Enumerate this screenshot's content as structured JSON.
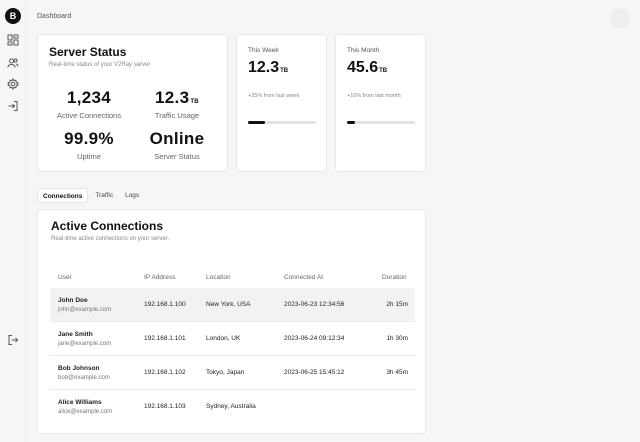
{
  "sidebar": {
    "logo": "B",
    "items": [
      {
        "icon": "dashboard-icon"
      },
      {
        "icon": "users-icon"
      },
      {
        "icon": "settings-icon"
      },
      {
        "icon": "login-icon"
      }
    ],
    "footer_icon": "logout-icon"
  },
  "header": {
    "breadcrumb": "Dashboard"
  },
  "server_status": {
    "title": "Server Status",
    "subtitle": "Real-time status of your V2Ray server",
    "active_connections": {
      "value": "1,234",
      "label": "Active Connections"
    },
    "traffic_usage": {
      "value": "12.3",
      "unit": "TB",
      "label": "Traffic Usage"
    },
    "uptime": {
      "value": "99.9%",
      "label": "Uptime"
    },
    "status": {
      "value": "Online",
      "label": "Server Status"
    }
  },
  "this_week": {
    "label": "This Week",
    "value": "12.3",
    "unit": "TB",
    "change": "+25% from last week",
    "progress": 0.25
  },
  "this_month": {
    "label": "This Month",
    "value": "45.6",
    "unit": "TB",
    "change": "+10% from last month",
    "progress": 0.12
  },
  "tabs": [
    "Connections",
    "Traffic",
    "Logs"
  ],
  "connections": {
    "title": "Active Connections",
    "subtitle": "Real-time active connections on your server.",
    "columns": [
      "User",
      "IP Address",
      "Location",
      "Connected At",
      "Duration"
    ],
    "rows": [
      {
        "name": "John Doe",
        "email": "john@example.com",
        "ip": "192.168.1.100",
        "location": "New York, USA",
        "connected": "2023-06-23 12:34:56",
        "duration": "2h 15m"
      },
      {
        "name": "Jane Smith",
        "email": "jane@example.com",
        "ip": "192.168.1.101",
        "location": "London, UK",
        "connected": "2023-06-24 09:12:34",
        "duration": "1h 30m"
      },
      {
        "name": "Bob Johnson",
        "email": "bob@example.com",
        "ip": "192.168.1.102",
        "location": "Tokyo, Japan",
        "connected": "2023-06-25 15:45:12",
        "duration": "3h 45m"
      },
      {
        "name": "Alice Williams",
        "email": "alice@example.com",
        "ip": "192.168.1.103",
        "location": "Sydney, Australia",
        "connected": "",
        "duration": ""
      }
    ]
  }
}
